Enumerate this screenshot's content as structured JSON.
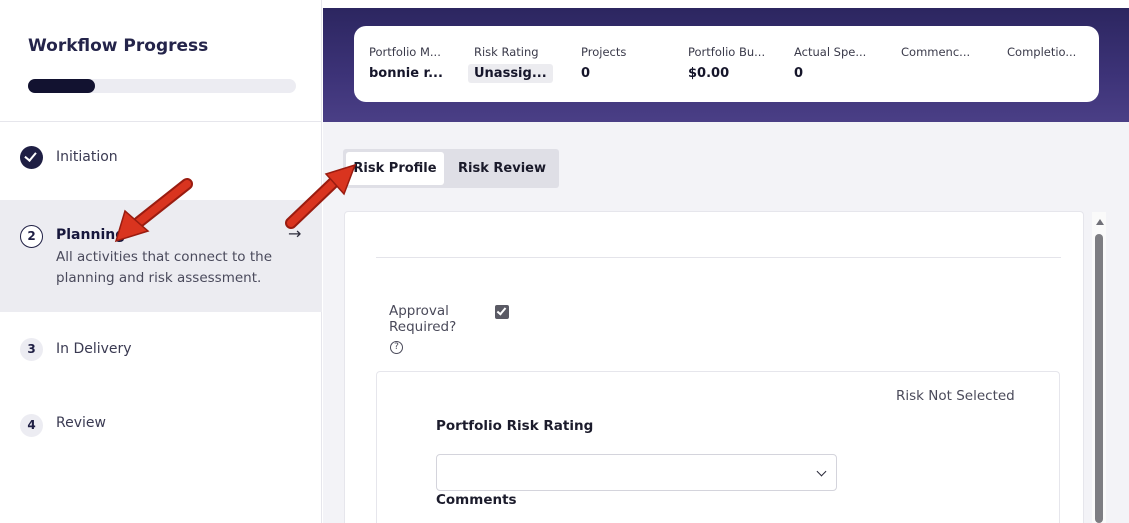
{
  "sidebar": {
    "title": "Workflow Progress",
    "progress_fraction": 0.25,
    "steps": [
      {
        "number": "1",
        "label": "Initiation",
        "state": "complete",
        "icon": "check-icon"
      },
      {
        "number": "2",
        "label": "Planning",
        "description": "All activities that connect to the planning and risk assessment.",
        "state": "active",
        "arrow": "→"
      },
      {
        "number": "3",
        "label": "In Delivery",
        "state": "pending"
      },
      {
        "number": "4",
        "label": "Review",
        "state": "pending"
      }
    ]
  },
  "summary": {
    "fields": [
      {
        "label": "Portfolio M...",
        "value": "bonnie r..."
      },
      {
        "label": "Risk Rating",
        "value": "Unassig..."
      },
      {
        "label": "Projects",
        "value": "0"
      },
      {
        "label": "Portfolio Bu...",
        "value": "$0.00"
      },
      {
        "label": "Actual Spe...",
        "value": "0"
      },
      {
        "label": "Commenc...",
        "value": ""
      },
      {
        "label": "Completio...",
        "value": ""
      }
    ]
  },
  "tabs": [
    {
      "label": "Risk Profile",
      "active": true
    },
    {
      "label": "Risk Review",
      "active": false
    }
  ],
  "form": {
    "approval_label": "Approval Required?",
    "approval_line1": "Approval",
    "approval_line2": "Required?",
    "help_glyph": "?",
    "approval_checked": true,
    "risk_status": "Risk Not Selected",
    "rating_label": "Portfolio Risk Rating",
    "rating_value": "",
    "comments_label": "Comments"
  },
  "colors": {
    "header_gradient_top": "#2c2660",
    "header_gradient_bottom": "#4a3f86",
    "annotation_arrow": "#d9341f",
    "progress_fill": "#121230",
    "active_step_bg": "#ececf1"
  }
}
